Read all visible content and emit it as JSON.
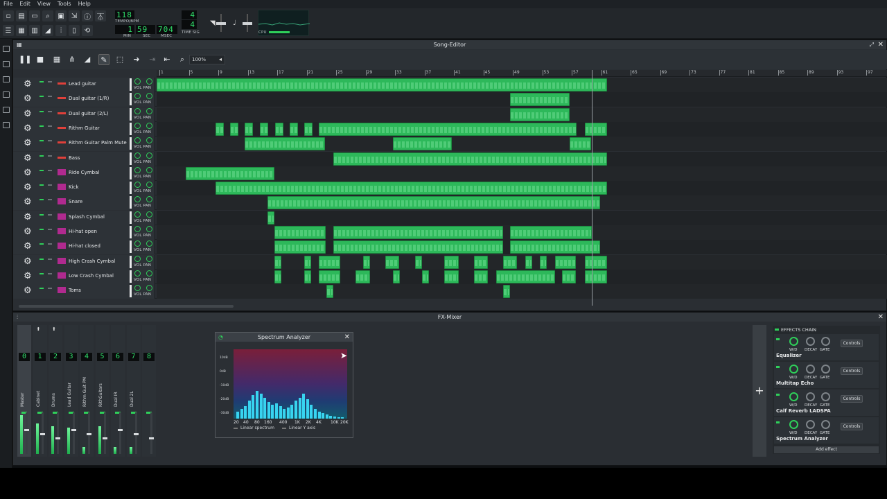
{
  "menu": [
    "File",
    "Edit",
    "View",
    "Tools",
    "Help"
  ],
  "toolbar": {
    "tempo": "118",
    "tempo_label": "TEMPO/BPM",
    "time_min": "1",
    "time_sec": "59",
    "time_msec": "704",
    "min_label": "MIN",
    "sec_label": "SEC",
    "msec_label": "MSEC",
    "timesig_num": "4",
    "timesig_den": "4",
    "timesig_label": "TIME SIG",
    "cpu_label": "CPU"
  },
  "song_editor": {
    "title": "Song-Editor",
    "zoom": "100%",
    "ruler": [
      "1",
      "5",
      "9",
      "13",
      "17",
      "21",
      "25",
      "29",
      "33",
      "37",
      "41",
      "45",
      "49",
      "53",
      "57",
      "61",
      "65",
      "69",
      "73",
      "77",
      "81",
      "85",
      "89",
      "93",
      "97"
    ],
    "tracks": [
      {
        "name": "Lead guitar",
        "type": "guitar"
      },
      {
        "name": "Dual guitar (1/R)",
        "type": "guitar"
      },
      {
        "name": "Dual guitar (2/L)",
        "type": "guitar"
      },
      {
        "name": "Rithm Guitar",
        "type": "guitar"
      },
      {
        "name": "Rithm Guitar Palm Mute",
        "type": "guitar"
      },
      {
        "name": "Bass",
        "type": "guitar"
      },
      {
        "name": "Ride Cymbal",
        "type": "drum"
      },
      {
        "name": "Kick",
        "type": "drum"
      },
      {
        "name": "Snare",
        "type": "drum"
      },
      {
        "name": "Splash Cymbal",
        "type": "drum"
      },
      {
        "name": "Hi-hat open",
        "type": "drum"
      },
      {
        "name": "Hi-hat closed",
        "type": "drum"
      },
      {
        "name": "High Crash Cymbal",
        "type": "drum"
      },
      {
        "name": "Low Crash Cymbal",
        "type": "drum"
      },
      {
        "name": "Toms",
        "type": "drum"
      }
    ],
    "vol_pan_label": "VOL PAN"
  },
  "fx_mixer": {
    "title": "FX-Mixer",
    "channels": [
      {
        "num": "0",
        "name": "Master"
      },
      {
        "num": "1",
        "name": "Cabinet"
      },
      {
        "num": "2",
        "name": "Drums"
      },
      {
        "num": "3",
        "name": "Lead Guitar"
      },
      {
        "num": "4",
        "name": "Rithm Guit PM"
      },
      {
        "num": "5",
        "name": "RithGuitars"
      },
      {
        "num": "6",
        "name": "Dual IR"
      },
      {
        "num": "7",
        "name": "Dual 2L"
      },
      {
        "num": "8",
        "name": ""
      }
    ],
    "effects_chain_label": "EFFECTS CHAIN",
    "add_effect": "Add effect",
    "controls_label": "Controls",
    "effects": [
      {
        "name": "Equalizer",
        "labels": [
          "W/D",
          "DECAY",
          "GATE"
        ]
      },
      {
        "name": "Multitap Echo",
        "labels": [
          "W/D",
          "DECAY",
          "GATE"
        ]
      },
      {
        "name": "Calf Reverb LADSPA",
        "labels": [
          "W/D",
          "DECAY",
          "GATE"
        ]
      },
      {
        "name": "Spectrum Analyzer",
        "labels": [
          "W/D",
          "DECAY",
          "GATE"
        ]
      }
    ]
  },
  "spectrum": {
    "title": "Spectrum Analyzer",
    "db_labels": [
      "10dB",
      "0dB",
      "-10dB",
      "-20dB",
      "-30dB"
    ],
    "freq_labels": [
      "20",
      "40",
      "80",
      "160",
      "400",
      "1K",
      "2K",
      "4K",
      "10K",
      "20K"
    ],
    "opt1": "Linear spectrum",
    "opt2": "Linear Y axis"
  }
}
